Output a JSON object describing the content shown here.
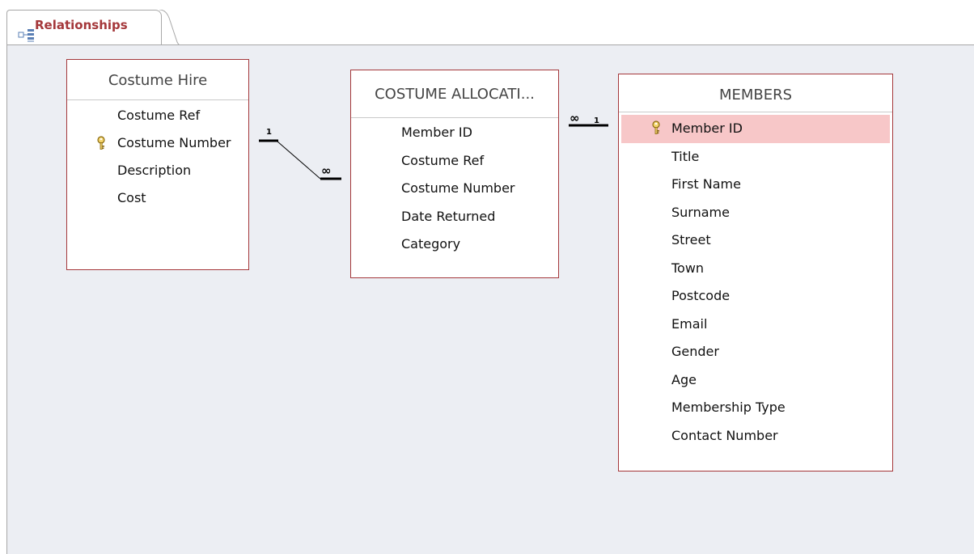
{
  "tab": {
    "label": "Relationships",
    "icon": "relationships-icon"
  },
  "colors": {
    "accent": "#a4373a",
    "canvas": "#eceef3",
    "highlight": "#f7c7c8"
  },
  "tables": {
    "costume_hire": {
      "title": "Costume Hire",
      "fields": [
        "Costume Ref",
        "Costume Number",
        "Description",
        "Cost"
      ],
      "primary_key": "Costume Number"
    },
    "costume_allocation": {
      "title": "COSTUME ALLOCATI...",
      "fields": [
        "Member ID",
        "Costume Ref",
        "Costume Number",
        "Date Returned",
        "Category"
      ]
    },
    "members": {
      "title": "MEMBERS",
      "fields": [
        "Member ID",
        "Title",
        "First Name",
        "Surname",
        "Street",
        "Town",
        "Postcode",
        "Email",
        "Gender",
        "Age",
        "Membership Type",
        "Contact Number"
      ],
      "primary_key": "Member ID"
    }
  },
  "relationships": {
    "hire_to_allocation": {
      "one": "1",
      "many": "∞"
    },
    "allocation_to_members": {
      "many": "∞",
      "one": "1"
    }
  }
}
